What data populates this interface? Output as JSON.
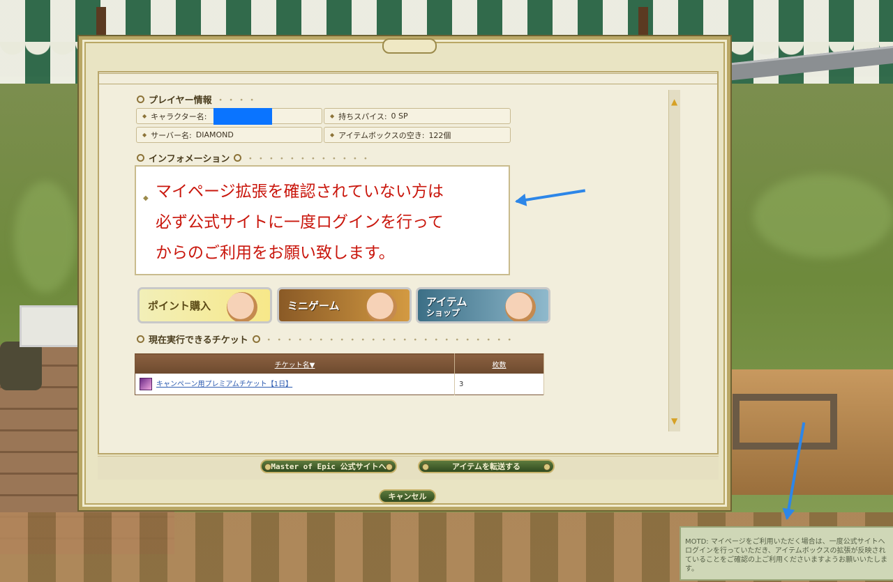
{
  "player_info": {
    "section_title": "プレイヤー情報",
    "character_label": "キャラクター名:",
    "server_label": "サーバー名:",
    "server_value": "DIAMOND",
    "spice_label": "持ちスパイス:",
    "spice_value": "0 SP",
    "itembox_label": "アイテムボックスの空き:",
    "itembox_value": "122個"
  },
  "information": {
    "section_title": "インフォメーション",
    "lines": [
      "マイページ拡張を確認されていない方は",
      "必ず公式サイトに一度ログインを行って",
      "からのご利用をお願い致します。"
    ]
  },
  "banners": {
    "point": "ポイント購入",
    "minigame": "ミニゲーム",
    "item_top": "アイテム",
    "item_bottom": "ショップ"
  },
  "tickets": {
    "section_title": "現在実行できるチケット",
    "headers": [
      "チケット名▼",
      "枚数"
    ],
    "rows": [
      {
        "name": "キャンペーン用プレミアムチケット【1日】",
        "count": "3"
      }
    ]
  },
  "footer": {
    "official_site_button": "Master of Epic 公式サイトへ",
    "transfer_button": "アイテムを転送する",
    "cancel_button": "キャンセル"
  },
  "motd": {
    "text": "MOTD: マイページをご利用いただく場合は、一度公式サイトへログインを行っていただき、アイテムボックスの拡張が反映されていることをご確認の上ご利用くださいますようお願いいたします。"
  },
  "colors": {
    "info_text": "#c9160c",
    "annotation_arrow": "#2d86e8",
    "redaction": "#0a74ff"
  }
}
